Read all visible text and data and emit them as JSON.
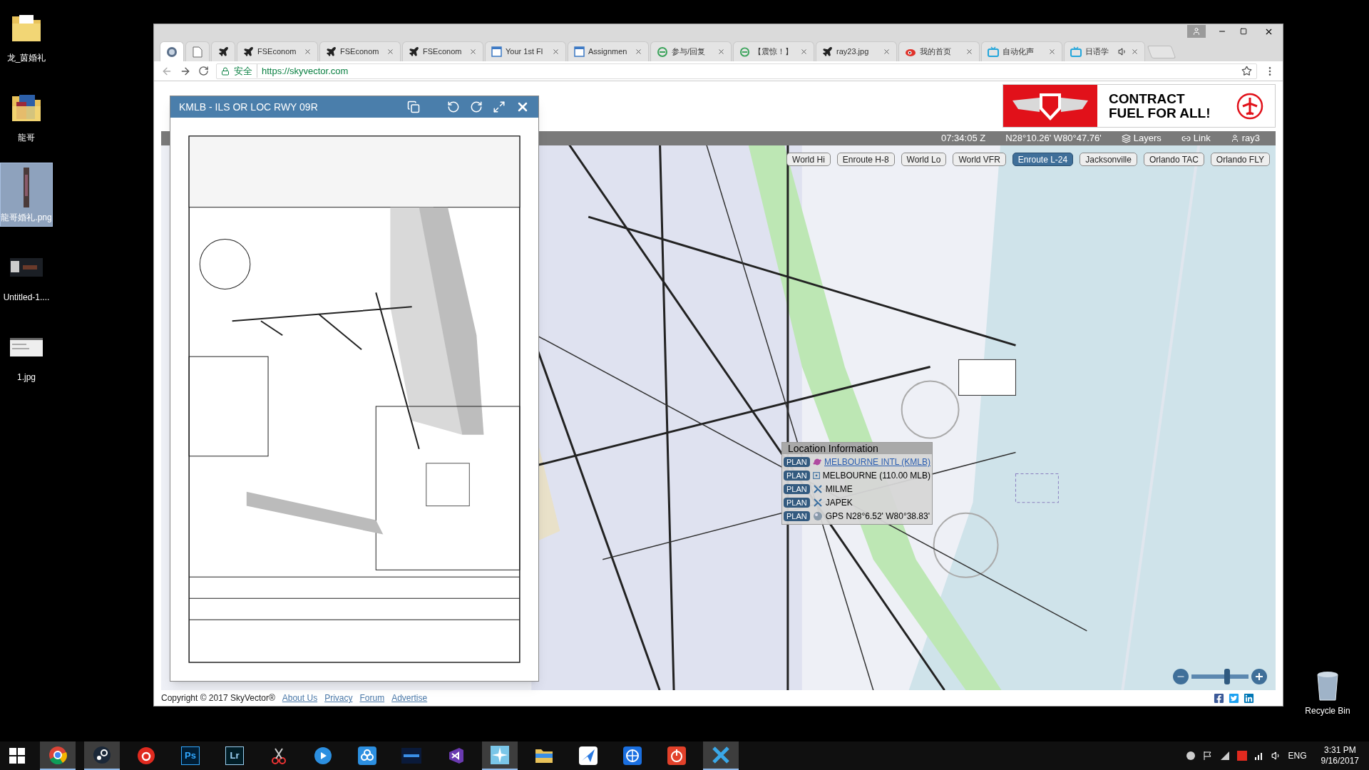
{
  "desktop": {
    "icons": [
      {
        "kind": "folder",
        "label": "龙_茵婚礼",
        "selected": false
      },
      {
        "kind": "folder-photo",
        "label": "龍哥",
        "selected": false
      },
      {
        "kind": "image-tall",
        "label": "龍哥婚礼.png",
        "selected": true
      },
      {
        "kind": "image-dark",
        "label": "Untitled-1....",
        "selected": false
      },
      {
        "kind": "image-light",
        "label": "1.jpg",
        "selected": false
      }
    ],
    "recycle_bin": {
      "label": "Recycle Bin"
    }
  },
  "browser": {
    "tabs": [
      {
        "kind": "globe",
        "pinned": true,
        "selected": true,
        "audio": false
      },
      {
        "kind": "page",
        "pinned": true,
        "selected": false,
        "audio": false
      },
      {
        "kind": "plane",
        "pinned": true,
        "selected": false,
        "audio": false
      },
      {
        "kind": "plane",
        "title": "FSEconom",
        "pinned": false,
        "selected": false,
        "audio": false
      },
      {
        "kind": "plane",
        "title": "FSEconom",
        "pinned": false,
        "selected": false,
        "audio": false
      },
      {
        "kind": "plane",
        "title": "FSEconom",
        "pinned": false,
        "selected": false,
        "audio": false
      },
      {
        "kind": "window",
        "title": "Your 1st Fl",
        "pinned": false,
        "selected": false,
        "audio": false
      },
      {
        "kind": "window",
        "title": "Assignmen",
        "pinned": false,
        "selected": false,
        "audio": false
      },
      {
        "kind": "swirl",
        "title": "参与/回复",
        "pinned": false,
        "selected": false,
        "audio": false
      },
      {
        "kind": "swirl",
        "title": "【震惊！】",
        "pinned": false,
        "selected": false,
        "audio": false
      },
      {
        "kind": "plane",
        "title": "ray23.jpg",
        "pinned": false,
        "selected": false,
        "audio": false
      },
      {
        "kind": "eye",
        "title": "我的首页",
        "pinned": false,
        "selected": false,
        "audio": false
      },
      {
        "kind": "tv",
        "title": "自动化声",
        "pinned": false,
        "selected": false,
        "audio": false
      },
      {
        "kind": "tv",
        "title": "日语学",
        "pinned": false,
        "selected": false,
        "audio": true
      }
    ],
    "address": {
      "secure_label": "安全",
      "url": "https://skyvector.com"
    }
  },
  "page": {
    "ad": {
      "headline": [
        "CONTRACT",
        "FUEL FOR ALL!"
      ]
    },
    "map_bar": {
      "time": "07:34:05 Z",
      "coords": "N28°10.26' W80°47.76'",
      "layers": "Layers",
      "link": "Link",
      "user": "ray3"
    },
    "chart_buttons": [
      {
        "label": "World Hi",
        "selected": false
      },
      {
        "label": "Enroute H-8",
        "selected": false
      },
      {
        "label": "World Lo",
        "selected": false
      },
      {
        "label": "World VFR",
        "selected": false
      },
      {
        "label": "Enroute L-24",
        "selected": true
      },
      {
        "label": "Jacksonville",
        "selected": false
      },
      {
        "label": "Orlando TAC",
        "selected": false
      },
      {
        "label": "Orlando FLY",
        "selected": false
      }
    ],
    "plate": {
      "title": "KMLB - ILS OR LOC RWY 09R"
    },
    "location_info": {
      "title": "Location Information",
      "entries": [
        {
          "action": "PLAN",
          "kind": "airport",
          "label": "MELBOURNE INTL (KMLB)",
          "link": true
        },
        {
          "action": "PLAN",
          "kind": "vor",
          "label": "MELBOURNE (110.00 MLB)",
          "link": false
        },
        {
          "action": "PLAN",
          "kind": "fix",
          "label": "MILME",
          "link": false
        },
        {
          "action": "PLAN",
          "kind": "fix",
          "label": "JAPEK",
          "link": false
        },
        {
          "action": "PLAN",
          "kind": "gps",
          "label": "GPS N28°6.52' W80°38.83'",
          "link": false
        }
      ]
    },
    "zoom": {
      "level": 0.62
    },
    "footer": {
      "copyright": "Copyright © 2017 SkyVector®",
      "links": [
        "About Us",
        "Privacy",
        "Forum",
        "Advertise"
      ]
    }
  },
  "taskbar": {
    "apps": [
      {
        "kind": "chrome",
        "open": true
      },
      {
        "kind": "steam",
        "open": true
      },
      {
        "kind": "music",
        "open": false
      },
      {
        "kind": "ps",
        "text": "Ps",
        "open": false
      },
      {
        "kind": "lr",
        "text": "Lr",
        "open": false
      },
      {
        "kind": "scissors",
        "open": false
      },
      {
        "kind": "player",
        "open": false
      },
      {
        "kind": "cloud",
        "open": false
      },
      {
        "kind": "blue",
        "open": false
      },
      {
        "kind": "vs",
        "open": false
      },
      {
        "kind": "sky",
        "open": true
      },
      {
        "kind": "folder",
        "open": false
      },
      {
        "kind": "bird",
        "open": false
      },
      {
        "kind": "globe",
        "open": false
      },
      {
        "kind": "power",
        "open": false
      },
      {
        "kind": "x",
        "open": true
      }
    ],
    "tray": {
      "language": "ENG",
      "time": "3:31 PM",
      "date": "9/16/2017"
    }
  }
}
